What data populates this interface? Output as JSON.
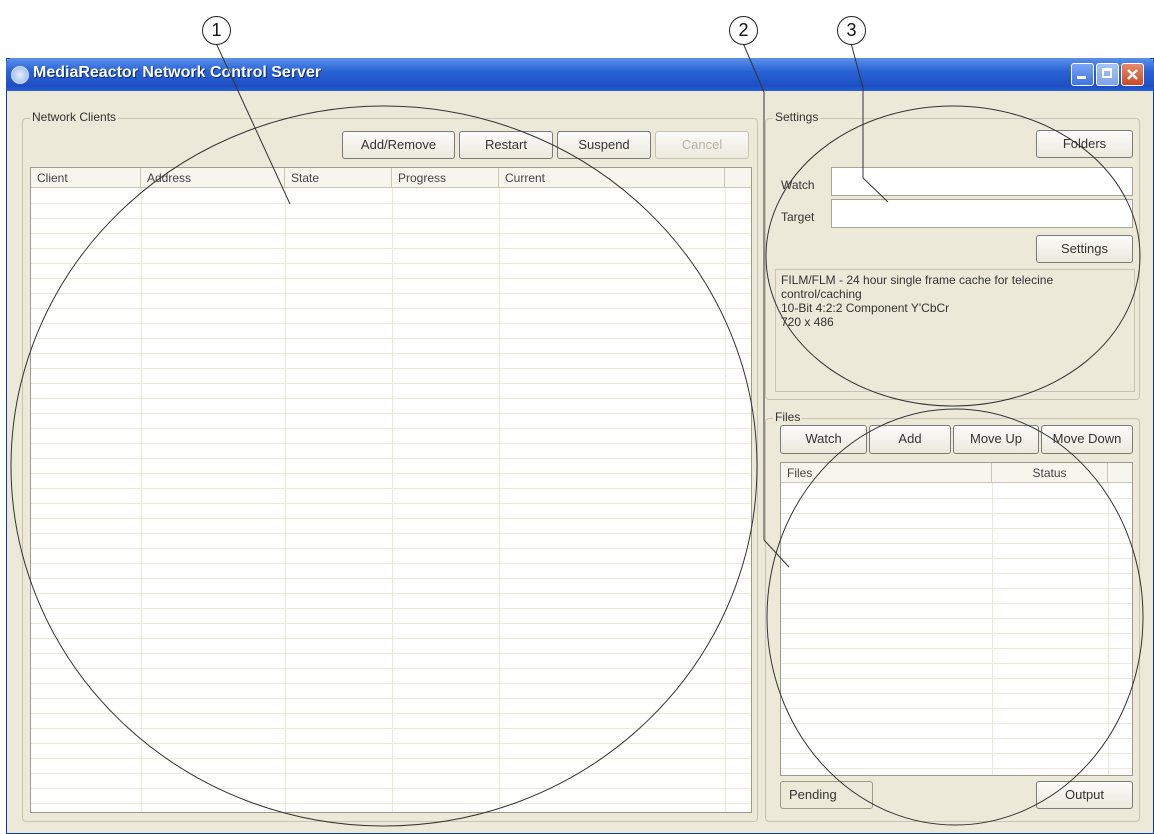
{
  "callouts": [
    "1",
    "2",
    "3"
  ],
  "title_bar": {
    "title": "MediaReactor Network Control Server",
    "minimize_icon": "minimize-icon",
    "maximize_icon": "maximize-icon",
    "close_icon": "close-icon"
  },
  "network_clients": {
    "group_label": "Network Clients",
    "buttons": {
      "add_remove": "Add/Remove",
      "restart": "Restart",
      "suspend": "Suspend",
      "cancel": "Cancel"
    },
    "columns": [
      "Client",
      "Address",
      "State",
      "Progress",
      "Current"
    ],
    "rows": []
  },
  "settings": {
    "group_label": "Settings",
    "folders_button": "Folders",
    "watch_label": "Watch",
    "watch_value": "",
    "target_label": "Target",
    "target_value": "",
    "settings_button": "Settings",
    "info_lines": [
      "FILM/FLM - 24 hour single frame cache for telecine",
      "control/caching",
      "10-Bit 4:2:2 Component Y'CbCr",
      "720 x 486"
    ]
  },
  "files": {
    "group_label": "Files",
    "buttons": {
      "watch": "Watch",
      "add": "Add",
      "move_up": "Move Up",
      "move_down": "Move Down"
    },
    "columns": [
      "Files",
      "Status"
    ],
    "rows": [],
    "tabs": {
      "pending": "Pending",
      "output": "Output"
    }
  },
  "colors": {
    "titlebar": "#2a63d6",
    "window_background": "#ece9d8",
    "close_button": "#c94a22"
  }
}
